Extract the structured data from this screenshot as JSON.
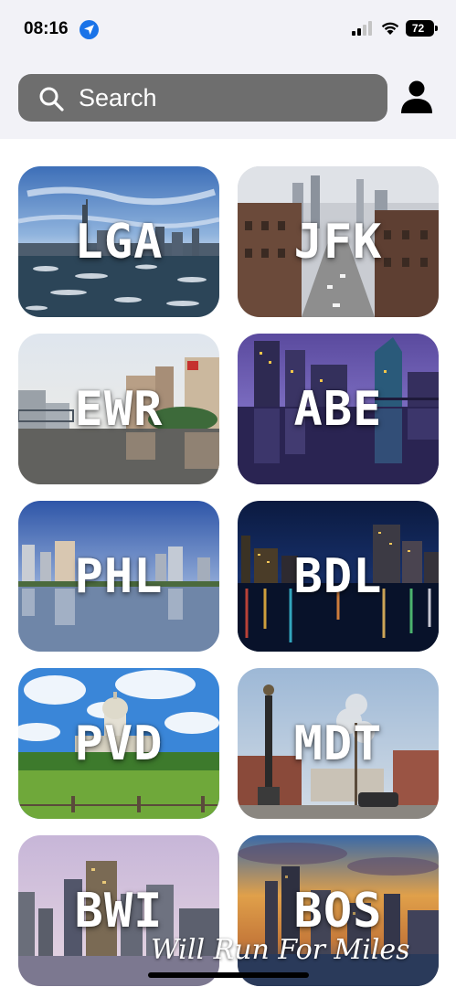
{
  "status_bar": {
    "time": "08:16",
    "battery": "72",
    "location_icon": "location-arrow-icon",
    "signal_icon": "cellular-signal-icon",
    "wifi_icon": "wifi-icon"
  },
  "header": {
    "search_label": "Search",
    "search_icon": "magnifier-icon",
    "profile_icon": "person-icon"
  },
  "airports": [
    {
      "code": "LGA",
      "scene": "skyline-over-icy-water"
    },
    {
      "code": "JFK",
      "scene": "city-street-aerial"
    },
    {
      "code": "EWR",
      "scene": "riverside-buildings"
    },
    {
      "code": "ABE",
      "scene": "night-skyline-reflection-purple"
    },
    {
      "code": "PHL",
      "scene": "river-skyline-blue"
    },
    {
      "code": "BDL",
      "scene": "night-city-lights-river"
    },
    {
      "code": "PVD",
      "scene": "capitol-dome-park"
    },
    {
      "code": "MDT",
      "scene": "square-monument-street"
    },
    {
      "code": "BWI",
      "scene": "harbor-skyline-dusk"
    },
    {
      "code": "BOS",
      "scene": "sunset-skyline-harbor"
    }
  ],
  "watermark": "Will Run For Miles",
  "colors": {
    "header_bg": "#f2f2f7",
    "search_bg": "#6e6e6e",
    "accent_location": "#1a73e8"
  }
}
